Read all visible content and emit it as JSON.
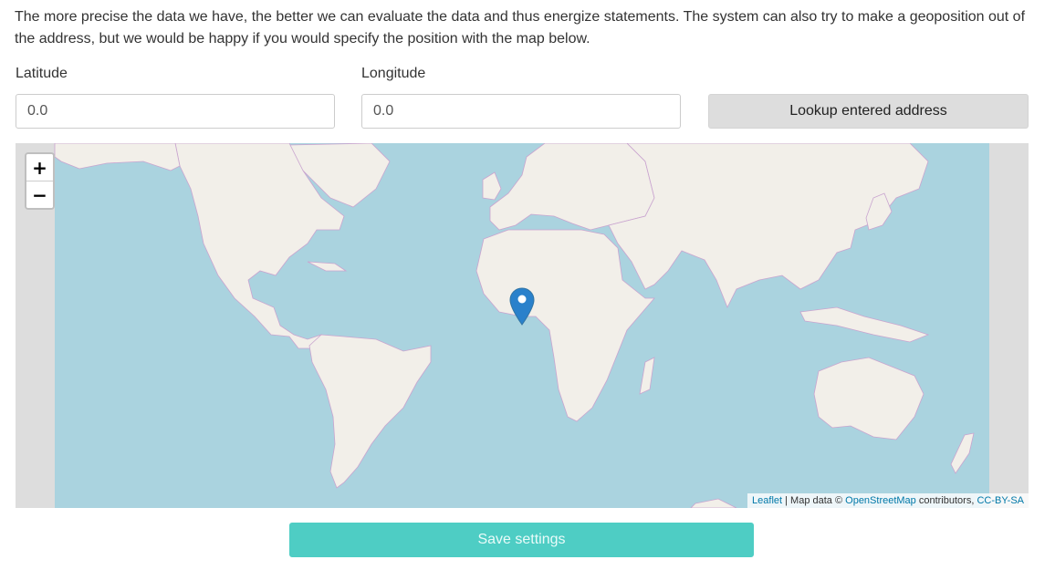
{
  "intro_text": "The more precise the data we have, the better we can evaluate the data and thus energize statements. The system can also try to make a geoposition out of the address, but we would be happy if you would specify the position with the map below.",
  "latitude": {
    "label": "Latitude",
    "value": "0.0"
  },
  "longitude": {
    "label": "Longitude",
    "value": "0.0"
  },
  "lookup_button": "Lookup entered address",
  "map": {
    "zoom_in": "+",
    "zoom_out": "−",
    "marker_icon": "map-pin-icon",
    "attribution": {
      "leaflet": "Leaflet",
      "map_data": " | Map data © ",
      "osm": "OpenStreetMap",
      "contributors": " contributors, ",
      "license": "CC-BY-SA"
    },
    "colors": {
      "water": "#aad3df",
      "land": "#f2efe9",
      "border": "#c9a4cf",
      "pin": "#2a81cb"
    }
  },
  "save_button": "Save settings"
}
